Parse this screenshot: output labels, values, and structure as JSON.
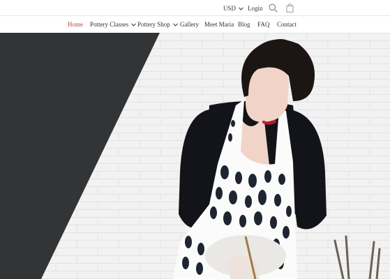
{
  "header": {
    "currency": "USD",
    "login_label": "Login",
    "icons": {
      "search": "search-icon",
      "cart": "shopping-bag-icon",
      "currency_caret": "chevron-down-icon"
    }
  },
  "nav": {
    "items": [
      {
        "label": "Home",
        "active": true
      },
      {
        "label": "Pottery Classes",
        "has_dropdown": true
      },
      {
        "label": "Pottery Shop",
        "has_dropdown": true
      },
      {
        "label": "Gallery"
      },
      {
        "label": "Meet Maria"
      },
      {
        "label": "Blog"
      },
      {
        "label": "FAQ"
      },
      {
        "label": "Contact"
      }
    ]
  },
  "colors": {
    "active_nav": "#b5443a",
    "dark_panel": "#333436",
    "brick_wall": "#f1f1f1",
    "apron": "#ffffff",
    "apron_spots": "#1f2530",
    "cardigan": "#121318"
  }
}
